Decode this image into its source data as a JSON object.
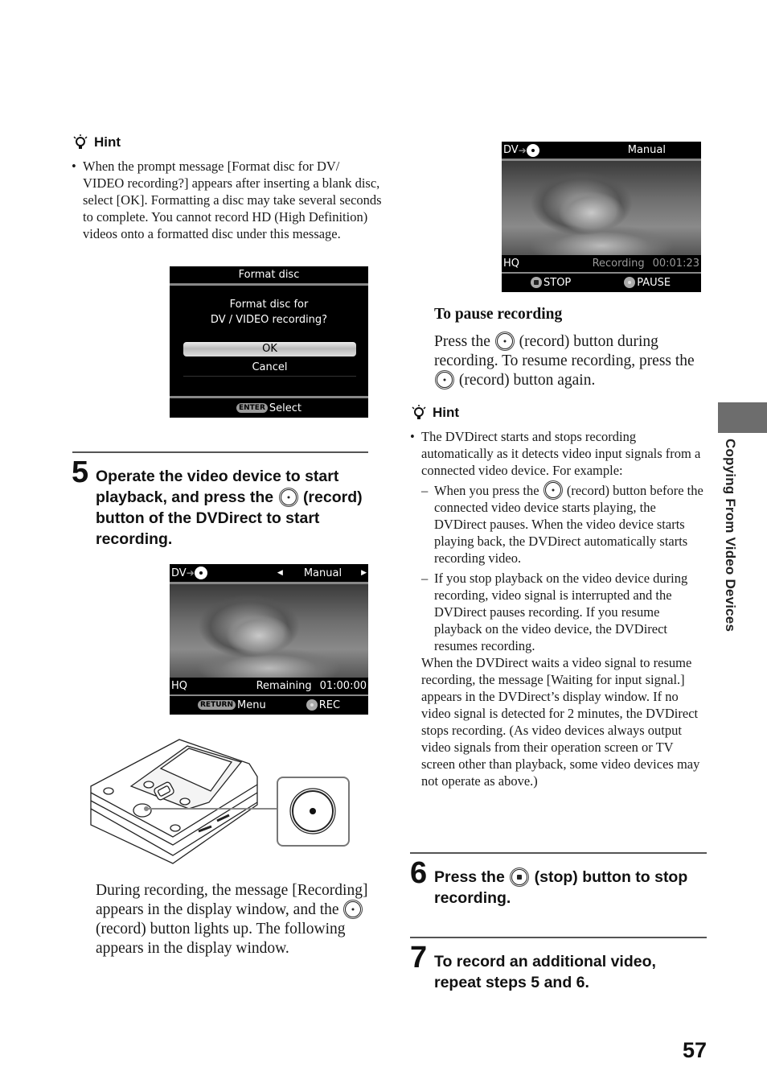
{
  "hint1": {
    "title": "Hint",
    "bullet": "When the prompt message [Format disc for DV/ VIDEO recording?] appears after inserting a blank disc, select [OK]. Formatting a disc may take several seconds to complete. You cannot record HD (High Definition) videos onto a formatted disc under this message."
  },
  "format_screen": {
    "title": "Format disc",
    "message_line1": "Format disc for",
    "message_line2": "DV / VIDEO recording?",
    "options": [
      "OK",
      "Cancel"
    ],
    "selected": "OK",
    "footer_key": "ENTER",
    "footer_label": "Select"
  },
  "step5": {
    "number": "5",
    "text_before": "Operate the video device to start playback, and press the",
    "text_after": "(record) button of the DVDirect to start recording."
  },
  "rec_screen": {
    "source": "DV",
    "mode": "Manual",
    "quality": "HQ",
    "status_label": "Remaining",
    "time": "01:00:00",
    "footer_key": "RETURN",
    "footer_left": "Menu",
    "footer_right": "REC"
  },
  "during_recording": {
    "text_before": "During recording, the message [Recording] appears in the display window, and the",
    "text_after": "(record) button lights up. The following appears in the display window."
  },
  "recording_screen": {
    "source": "DV",
    "mode": "Manual",
    "quality": "HQ",
    "status_label": "Recording",
    "time": "00:01:23",
    "footer_left": "STOP",
    "footer_right": "PAUSE"
  },
  "pause": {
    "heading": "To pause recording",
    "p1": "Press the",
    "p2": "(record) button during recording. To resume recording, press the",
    "p3": "(record) button again."
  },
  "hint2": {
    "title": "Hint",
    "bullet": "The DVDirect starts and stops recording automatically as it detects video input signals from a connected video device. For example:",
    "dash1_before": "When you press the",
    "dash1_after": "(record) button before the connected video device starts playing, the DVDirect pauses. When the video device starts playing back, the DVDirect automatically starts recording video.",
    "dash2": "If you stop playback on the video device during recording, video signal is interrupted and the DVDirect pauses recording. If you resume playback on the video device, the DVDirect resumes recording.",
    "para": "When the DVDirect waits a video signal to resume recording, the message [Waiting for input signal.] appears in the DVDirect’s display window. If no video signal is detected for 2 minutes, the DVDirect stops recording. (As video devices always output video signals from their operation screen or TV screen other than playback, some video devices may not operate as above.)"
  },
  "step6": {
    "number": "6",
    "text_before": "Press the",
    "text_after": "(stop) button to stop recording."
  },
  "step7": {
    "number": "7",
    "text": "To record an additional video, repeat steps 5 and 6."
  },
  "sidebar": {
    "section": "Copying From Video Devices"
  },
  "page_number": "57"
}
